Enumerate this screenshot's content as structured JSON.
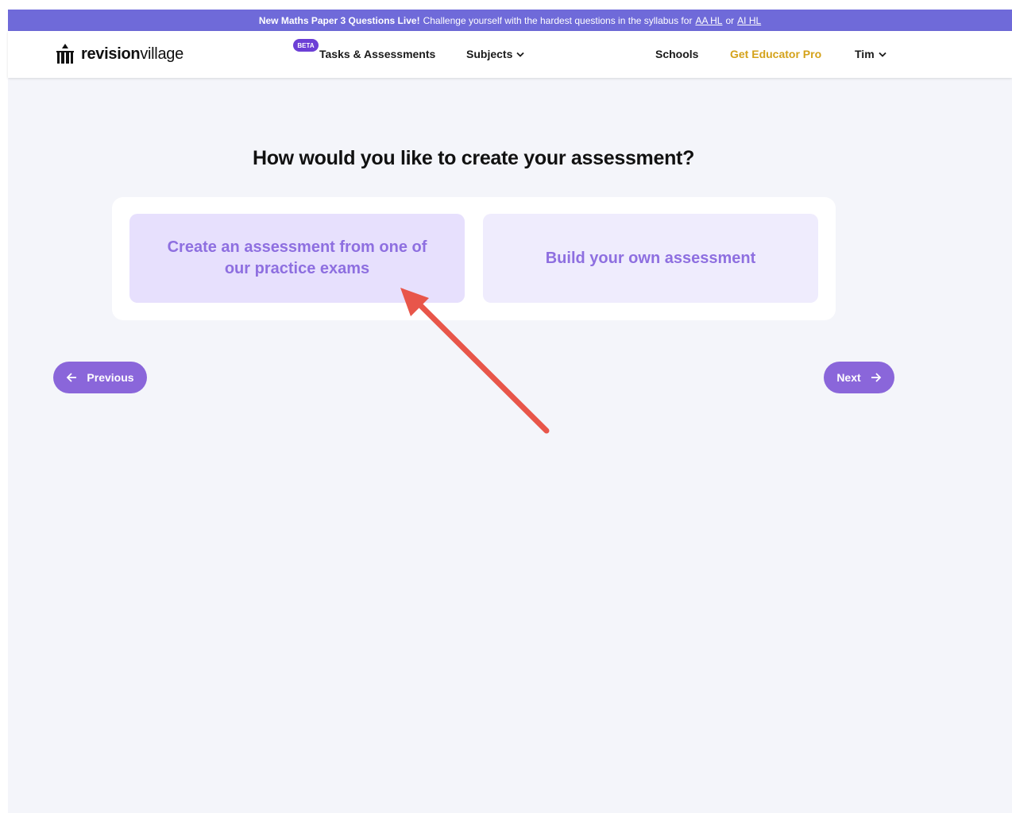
{
  "banner": {
    "bold_text": "New Maths Paper 3 Questions Live!",
    "text": "Challenge yourself with the hardest questions in the syllabus for",
    "link_aa": "AA HL",
    "or_text": "or",
    "link_ai": "AI HL"
  },
  "navbar": {
    "logo_bold": "revision",
    "logo_regular": "village",
    "beta_badge": "BETA",
    "tasks_label": "Tasks & Assessments",
    "subjects_label": "Subjects",
    "schools_label": "Schools",
    "educator_label": "Get Educator Pro",
    "user_label": "Tim"
  },
  "main": {
    "heading": "How would you like to create your assessment?",
    "option_practice": "Create an assessment from one of our practice exams",
    "option_build": "Build your own assessment",
    "previous_label": "Previous",
    "next_label": "Next"
  },
  "colors": {
    "banner": "#6f6ad9",
    "accent": "#8a66da",
    "option_text": "#8e6fe0",
    "educator": "#d4a21a",
    "annotation_arrow": "#e8564a"
  },
  "icons": [
    "logo-icon",
    "chevron-down-icon",
    "arrow-left-icon",
    "arrow-right-icon",
    "annotation-arrow"
  ]
}
